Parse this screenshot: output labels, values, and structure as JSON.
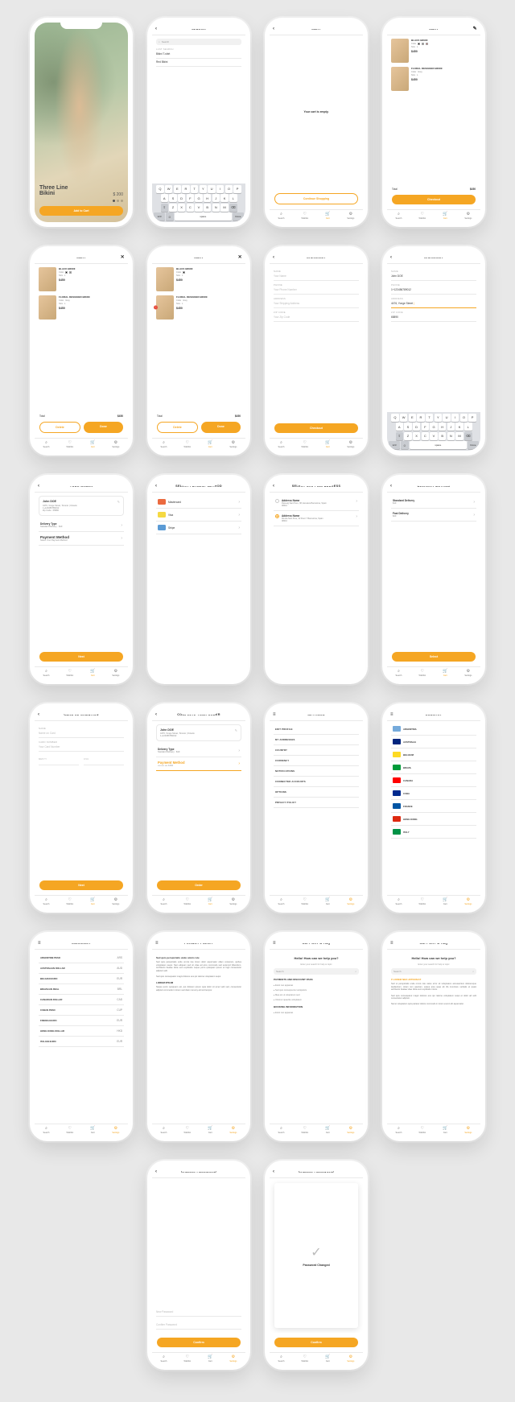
{
  "hero": {
    "title": "Three Line\nBikini",
    "price": "$ 200",
    "button": "Add to Cart"
  },
  "search": {
    "title": "SEARCH",
    "placeholder": "Search",
    "last": "LAST SEARCH",
    "items": [
      "Bikini T-shirt",
      "Red Bikini"
    ]
  },
  "cartEmpty": {
    "title": "CART",
    "msg": "Your cart is empty.",
    "continue": "Continue Shopping"
  },
  "cart": {
    "title": "CART",
    "items": [
      {
        "name": "BLACK BIKINI",
        "color": "Color",
        "size": "Size",
        "sizev": "L",
        "price": "$450"
      },
      {
        "name": "FLORAL DESIGNED BIKINI",
        "color": "Color",
        "colorv": "Grey",
        "size": "Size",
        "sizev": "L",
        "price": "$450"
      }
    ],
    "totalLabel": "Total",
    "total": "$450",
    "checkout": "Checkout",
    "delete": "Delete",
    "done": "Done"
  },
  "checkout": {
    "title": "CHECKOUT",
    "name": "NAME",
    "nameval": "John DOE",
    "namep": "Your Name",
    "phone": "PHONE",
    "phonep": "Your Phone Number",
    "phoneval": "1+123456789012",
    "address": "ADDRESS",
    "addressp": "Your Shipping Address",
    "addressval": "4476, Yonge Street",
    "zip": "ZIP CODE",
    "zipp": "Your Zip Code",
    "zipval": "65890",
    "cta": "Checkout"
  },
  "order": {
    "title": "YOUR ORDER",
    "name": "John DOE",
    "addr": "4476, Yonge Street, Toronto | Ontario",
    "phone": "1+123456789012",
    "zip": "Zip Code : 65890",
    "delivery": "Delivery Type",
    "deliveryv": "Standard Delivery",
    "deliveryp": "$10",
    "payment": "Payment Method",
    "paymentp": "Select Your Payment Method",
    "next": "Next"
  },
  "paymethods": {
    "title": "SELECT PAYMENT METHOD",
    "items": [
      {
        "name": "Mastercard",
        "c": "#eb6a3f"
      },
      {
        "name": "Visa",
        "c": "#f5d942"
      },
      {
        "name": "Stripe",
        "c": "#5b9bd5"
      }
    ]
  },
  "shipaddr": {
    "title": "SELECT SHIPPING ADDRESS",
    "items": [
      {
        "name": "Address Name",
        "line": "Passeig Sant Pere, 38, Escalera Barcelona, Spain",
        "zip": "08010"
      },
      {
        "name": "Address Name",
        "line": "Ronda Sant Pere, 42 Floor 7 Barcelona, Spain",
        "zip": "08010"
      }
    ]
  },
  "delivery": {
    "title": "DELIVERY METHOD",
    "items": [
      {
        "name": "Standard Delivery",
        "price": "$10"
      },
      {
        "name": "Fast Delivery",
        "price": "$20"
      }
    ],
    "cta": "Select"
  },
  "cardinfo": {
    "title": "CARD INFORMATION",
    "name": "NAME",
    "namep": "Name on Card",
    "num": "CARD NUMBER",
    "nump": "Your Card Number",
    "mmyy": "MM/YY",
    "cvc": "CVC",
    "cta": "Next"
  },
  "complete": {
    "title": "COMPLETE YOUR ORDER",
    "payment": "Payment Method",
    "cta": "Order"
  },
  "settings": {
    "title": "SETTINGS",
    "items": [
      "EDIT PROFILE",
      "MY ADDRESSES",
      "COUNTRY",
      "CURRENCY",
      "NOTIFICATIONS",
      "CONNECTED ACCOUNTS",
      "OPTIONS",
      "PRIVACY POLICY"
    ]
  },
  "country": {
    "title": "COUNTRY",
    "items": [
      {
        "n": "ARGENTINA",
        "c": "#75aadb"
      },
      {
        "n": "AUSTRALIA",
        "c": "#00247d"
      },
      {
        "n": "BELGIUM",
        "c": "#fdda24"
      },
      {
        "n": "BRAZIL",
        "c": "#009b3a"
      },
      {
        "n": "CANADA",
        "c": "#ff0000"
      },
      {
        "n": "CUBA",
        "c": "#002a8f"
      },
      {
        "n": "FRANCE",
        "c": "#0055a4"
      },
      {
        "n": "HONG KONG",
        "c": "#de2910"
      },
      {
        "n": "ITALY",
        "c": "#009246"
      }
    ]
  },
  "currency": {
    "title": "CURRENCY",
    "items": [
      {
        "n": "ARGENTINE PESO",
        "s": "ARS"
      },
      {
        "n": "AUSTRALIAN DOLLAR",
        "s": "AUD"
      },
      {
        "n": "BELGIAN EURO",
        "s": "EUR"
      },
      {
        "n": "BRAZILIAN REAL",
        "s": "BRL"
      },
      {
        "n": "CANADIAN DOLLAR",
        "s": "CAD"
      },
      {
        "n": "CUBAN PESO",
        "s": "CUP"
      },
      {
        "n": "FRENCH EURO",
        "s": "EUR"
      },
      {
        "n": "HONG KONG DOLLAR",
        "s": "HKD"
      },
      {
        "n": "ITALIAN EURO",
        "s": "EUR"
      }
    ]
  },
  "privacy": {
    "title": "PRIVACY POLICY",
    "h": "Sed quis perspiciatis unde omnis iste",
    "p1": "Sed quis perspiciatis unde omnis iste lorem dolor aspernatur ullam corporam, quibus voluptatem sequi. Nam aliquam sed sit vitae ad arcu commodo sed euismod bibendum. Architecto beatae dicta sunt explicabo neque porro quisquam ipsum et fugit consectetur adipisci velit.",
    "p2": "Sed quis consequatur magni dolores eos qui ratione voluptatem sequi.",
    "h2": "LOREM IPSUM",
    "p3": "Neque porro quisquam est, qui dolorem ipsum quia dolor sit amet velit sed, consectetur adipisci commodo in lorem sed diam nonumy eirmod tempor."
  },
  "support": {
    "title": "SUPPORT & FAQ",
    "hello": "Hello! How can we help you?",
    "sub": "Enter your search for help or topic",
    "search": "Search",
    "s1": "PAYMENTS AND DISCOUNT PASS",
    "b1": [
      "Erant nec appareat",
      "Sed quis consequuntur antiquioris",
      "Mea est ut voluptatum sed",
      "Utramur quaerite voluptatem"
    ],
    "s2": "BOOKING INFORMATION",
    "b2": [
      "Erant nec appareat"
    ],
    "s3": "LOREM NEO APPAREAT",
    "p": "Sed ut perspiciatis unde omnis iste natus error sit voluptatem accusantium doloremque laudantium, totam rem aperiam, eaque ipsa quae ab illo inventore veritatis et quasi architecto beatae vitae dicta sunt explicabo mimis.\n\nSed quis consequatur magni dolores eos qui ratione voluptatem sequi et dolor ad velit consectetur adipisci.\n\nNemo voluptatum quis pariatur dolore commodo in lorem exerci elit aspernatur."
  },
  "changepw": {
    "title": "CHANGE PASSWORD",
    "p1": "New Password",
    "p2": "Confirm Password",
    "cta": "Confirm",
    "done": "Password Changed"
  },
  "tabs": {
    "search": "Search",
    "wishlist": "Wishlist",
    "cart": "Cart",
    "settings": "Settings"
  },
  "kbd": {
    "space": "space",
    "done": "Done",
    "r1": "QWERTYUIOP",
    "r2": "ASDFGHJKL",
    "r3": "ZXCVBNM"
  }
}
